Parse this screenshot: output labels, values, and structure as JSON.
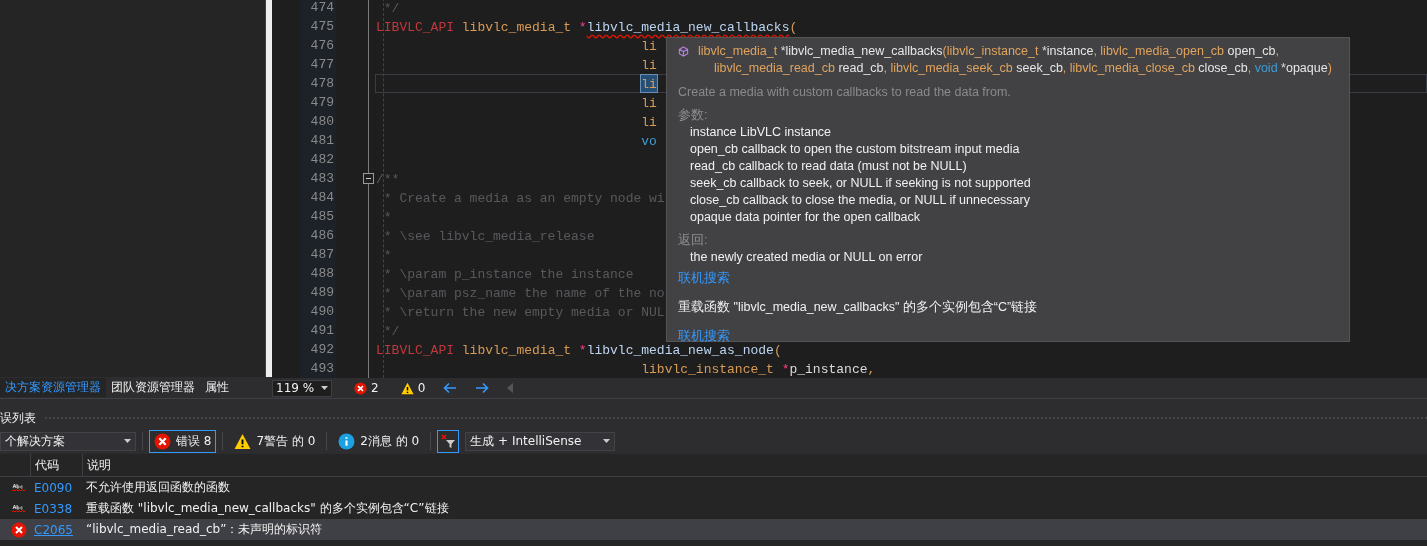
{
  "code_lines": [
    {
      "num": "474",
      "kind": "doc",
      "current": false,
      "tokens": [
        {
          "text": "*/",
          "kind": "comment"
        }
      ]
    },
    {
      "num": "475",
      "kind": "code",
      "current": false,
      "tokens": [
        {
          "text": "LIBVLC_API",
          "kind": "macro"
        },
        {
          "text": "libvlc_media_t",
          "kind": "type"
        },
        {
          "text": "*",
          "kind": "op"
        },
        {
          "text": "libvlc_media_new_callbacks",
          "kind": "error-func"
        },
        {
          "text": "(",
          "kind": "paren"
        }
      ]
    },
    {
      "num": "476",
      "kind": "args",
      "current": false,
      "tokens": [
        {
          "text": "li",
          "kind": "type"
        }
      ]
    },
    {
      "num": "477",
      "kind": "args",
      "current": false,
      "tokens": [
        {
          "text": "li",
          "kind": "type"
        }
      ]
    },
    {
      "num": "478",
      "kind": "args",
      "current": true,
      "tokens": [
        {
          "text": "li",
          "kind": "type"
        }
      ]
    },
    {
      "num": "479",
      "kind": "args",
      "current": false,
      "tokens": [
        {
          "text": "li",
          "kind": "type"
        }
      ]
    },
    {
      "num": "480",
      "kind": "args",
      "current": false,
      "tokens": [
        {
          "text": "li",
          "kind": "type"
        }
      ]
    },
    {
      "num": "481",
      "kind": "args",
      "current": false,
      "tokens": [
        {
          "text": "vo",
          "kind": "keyword"
        }
      ]
    },
    {
      "num": "482",
      "kind": "code",
      "current": false
    },
    {
      "num": "483",
      "kind": "fold",
      "current": false,
      "tokens": [
        {
          "text": "/**",
          "kind": "comment"
        }
      ]
    },
    {
      "num": "484",
      "kind": "doc",
      "current": false,
      "tokens": [
        {
          "text": "* Create a media as an empty node wi",
          "kind": "comment"
        }
      ]
    },
    {
      "num": "485",
      "kind": "doc",
      "current": false,
      "tokens": [
        {
          "text": "*",
          "kind": "comment"
        }
      ]
    },
    {
      "num": "486",
      "kind": "doc",
      "current": false,
      "tokens": [
        {
          "text": "* \\see libvlc_media_release",
          "kind": "comment"
        }
      ]
    },
    {
      "num": "487",
      "kind": "doc",
      "current": false,
      "tokens": [
        {
          "text": "*",
          "kind": "comment"
        }
      ]
    },
    {
      "num": "488",
      "kind": "doc",
      "current": false,
      "tokens": [
        {
          "text": "* \\param p_instance the instance",
          "kind": "comment"
        }
      ]
    },
    {
      "num": "489",
      "kind": "doc",
      "current": false,
      "tokens": [
        {
          "text": "* \\param psz_name the name of the no",
          "kind": "comment"
        }
      ]
    },
    {
      "num": "490",
      "kind": "doc",
      "current": false,
      "tokens": [
        {
          "text": "* \\return the new empty media or NUL",
          "kind": "comment"
        }
      ]
    },
    {
      "num": "491",
      "kind": "doc",
      "current": false,
      "tokens": [
        {
          "text": "*/",
          "kind": "comment"
        }
      ]
    },
    {
      "num": "492",
      "kind": "code",
      "current": false,
      "tokens": [
        {
          "text": "LIBVLC_API",
          "kind": "macro"
        },
        {
          "text": "libvlc_media_t",
          "kind": "type"
        },
        {
          "text": "*",
          "kind": "op"
        },
        {
          "text": "libvlc_media_new_as_node",
          "kind": "func"
        },
        {
          "text": "(",
          "kind": "paren"
        }
      ]
    },
    {
      "num": "493",
      "kind": "args",
      "current": false,
      "tokens": [
        {
          "text": "libvlc_instance_t",
          "kind": "type"
        },
        {
          "text": "*",
          "kind": "op"
        },
        {
          "text": "p_instance",
          "kind": "param"
        },
        {
          "text": ",",
          "kind": "paren"
        }
      ]
    }
  ],
  "editor_status": {
    "zoom": "119 %",
    "errors": "2",
    "warnings": "0"
  },
  "tooltip": {
    "signature": [
      [
        {
          "text": "libvlc_media_t ",
          "kind": "type"
        },
        {
          "text": "*",
          "kind": "op"
        },
        {
          "text": "libvlc_media_new_callbacks",
          "kind": "plain"
        },
        {
          "text": "(libvlc_instance_t ",
          "kind": "type"
        },
        {
          "text": "*",
          "kind": "op"
        },
        {
          "text": "instance",
          "kind": "plain"
        },
        {
          "text": ", libvlc_media_open_cb ",
          "kind": "type"
        },
        {
          "text": "open_cb",
          "kind": "plain"
        },
        {
          "text": ",",
          "kind": "type"
        }
      ],
      [
        {
          "text": "libvlc_media_read_cb ",
          "kind": "type"
        },
        {
          "text": "read_cb",
          "kind": "plain"
        },
        {
          "text": ", libvlc_media_seek_cb ",
          "kind": "type"
        },
        {
          "text": "seek_cb",
          "kind": "plain"
        },
        {
          "text": ", libvlc_media_close_cb ",
          "kind": "type"
        },
        {
          "text": "close_cb",
          "kind": "plain"
        },
        {
          "text": ", ",
          "kind": "type"
        },
        {
          "text": "void ",
          "kind": "keyword"
        },
        {
          "text": "*",
          "kind": "op"
        },
        {
          "text": "opaque",
          "kind": "plain"
        },
        {
          "text": ")",
          "kind": "type"
        }
      ]
    ],
    "description": "Create a media with custom callbacks to read the data from.",
    "params_label": "参数:",
    "params": [
      "instance LibVLC instance",
      "open_cb callback to open the custom bitstream input media",
      "read_cb callback to read data (must not be NULL)",
      "seek_cb callback to seek, or NULL if seeking is not supported",
      "close_cb callback to close the media, or NULL if unnecessary",
      "opaque data pointer for the open callback"
    ],
    "returns_label": "返回:",
    "returns": "the newly created media or NULL on error",
    "search_link_1": "联机搜索",
    "message": "重载函数 \"libvlc_media_new_callbacks\" 的多个实例包含“C”链接",
    "search_link_2": "联机搜索"
  },
  "panel_tabs": [
    {
      "label": "决方案资源管理器",
      "selected": true
    },
    {
      "label": "团队资源管理器",
      "selected": false
    },
    {
      "label": "属性",
      "selected": false
    }
  ],
  "error_list": {
    "title": "误列表",
    "scope": "个解决方案",
    "filters": [
      {
        "kind": "error",
        "label": "错误 8",
        "selected": true
      },
      {
        "kind": "warning",
        "label": "7警告 的 0",
        "selected": false
      },
      {
        "kind": "info",
        "label": "2消息 的 0",
        "selected": false
      }
    ],
    "clear_filter_selected": true,
    "source": "生成 + IntelliSense",
    "columns": [
      "代码",
      "说明"
    ],
    "rows": [
      {
        "kind": "spell",
        "code": "E0090",
        "description": "不允许使用返回函数的函数",
        "selected": false
      },
      {
        "kind": "spell",
        "code": "E0338",
        "description": "重载函数 \"libvlc_media_new_callbacks\" 的多个实例包含“C”链接",
        "selected": false
      },
      {
        "kind": "error",
        "code": "C2065",
        "description": "“libvlc_media_read_cb”：未声明的标识符",
        "selected": true
      }
    ]
  }
}
